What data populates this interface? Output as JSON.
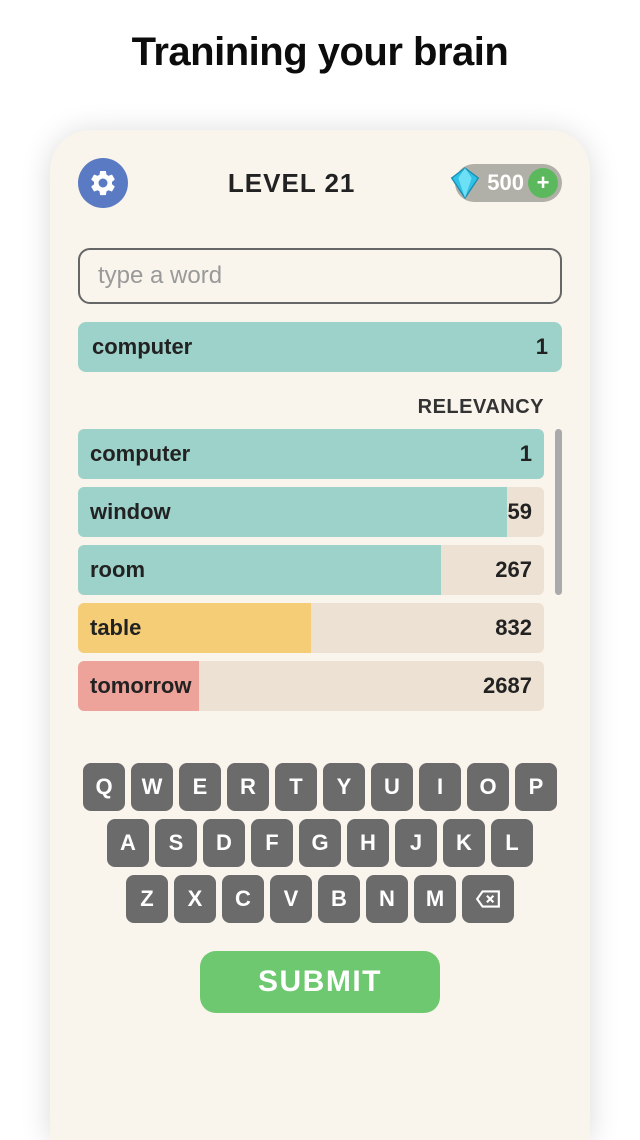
{
  "tagline": "Tranining your brain",
  "level_label": "LEVEL 21",
  "gems": "500",
  "input": {
    "placeholder": "type a word"
  },
  "current": {
    "word": "computer",
    "score": "1"
  },
  "relevancy_label": "RELEVANCY",
  "guesses": [
    {
      "word": "computer",
      "score": "1",
      "fill_pct": 100,
      "color": "#9dd2ca"
    },
    {
      "word": "window",
      "score": "59",
      "fill_pct": 92,
      "color": "#9dd2ca"
    },
    {
      "word": "room",
      "score": "267",
      "fill_pct": 78,
      "color": "#9dd2ca"
    },
    {
      "word": "table",
      "score": "832",
      "fill_pct": 50,
      "color": "#f4cd76"
    },
    {
      "word": "tomorrow",
      "score": "2687",
      "fill_pct": 26,
      "color": "#eda39a"
    }
  ],
  "keyboard": {
    "row1": [
      "Q",
      "W",
      "E",
      "R",
      "T",
      "Y",
      "U",
      "I",
      "O",
      "P"
    ],
    "row2": [
      "A",
      "S",
      "D",
      "F",
      "G",
      "H",
      "J",
      "K",
      "L"
    ],
    "row3": [
      "Z",
      "X",
      "C",
      "V",
      "B",
      "N",
      "M"
    ]
  },
  "submit_label": "SUBMIT"
}
